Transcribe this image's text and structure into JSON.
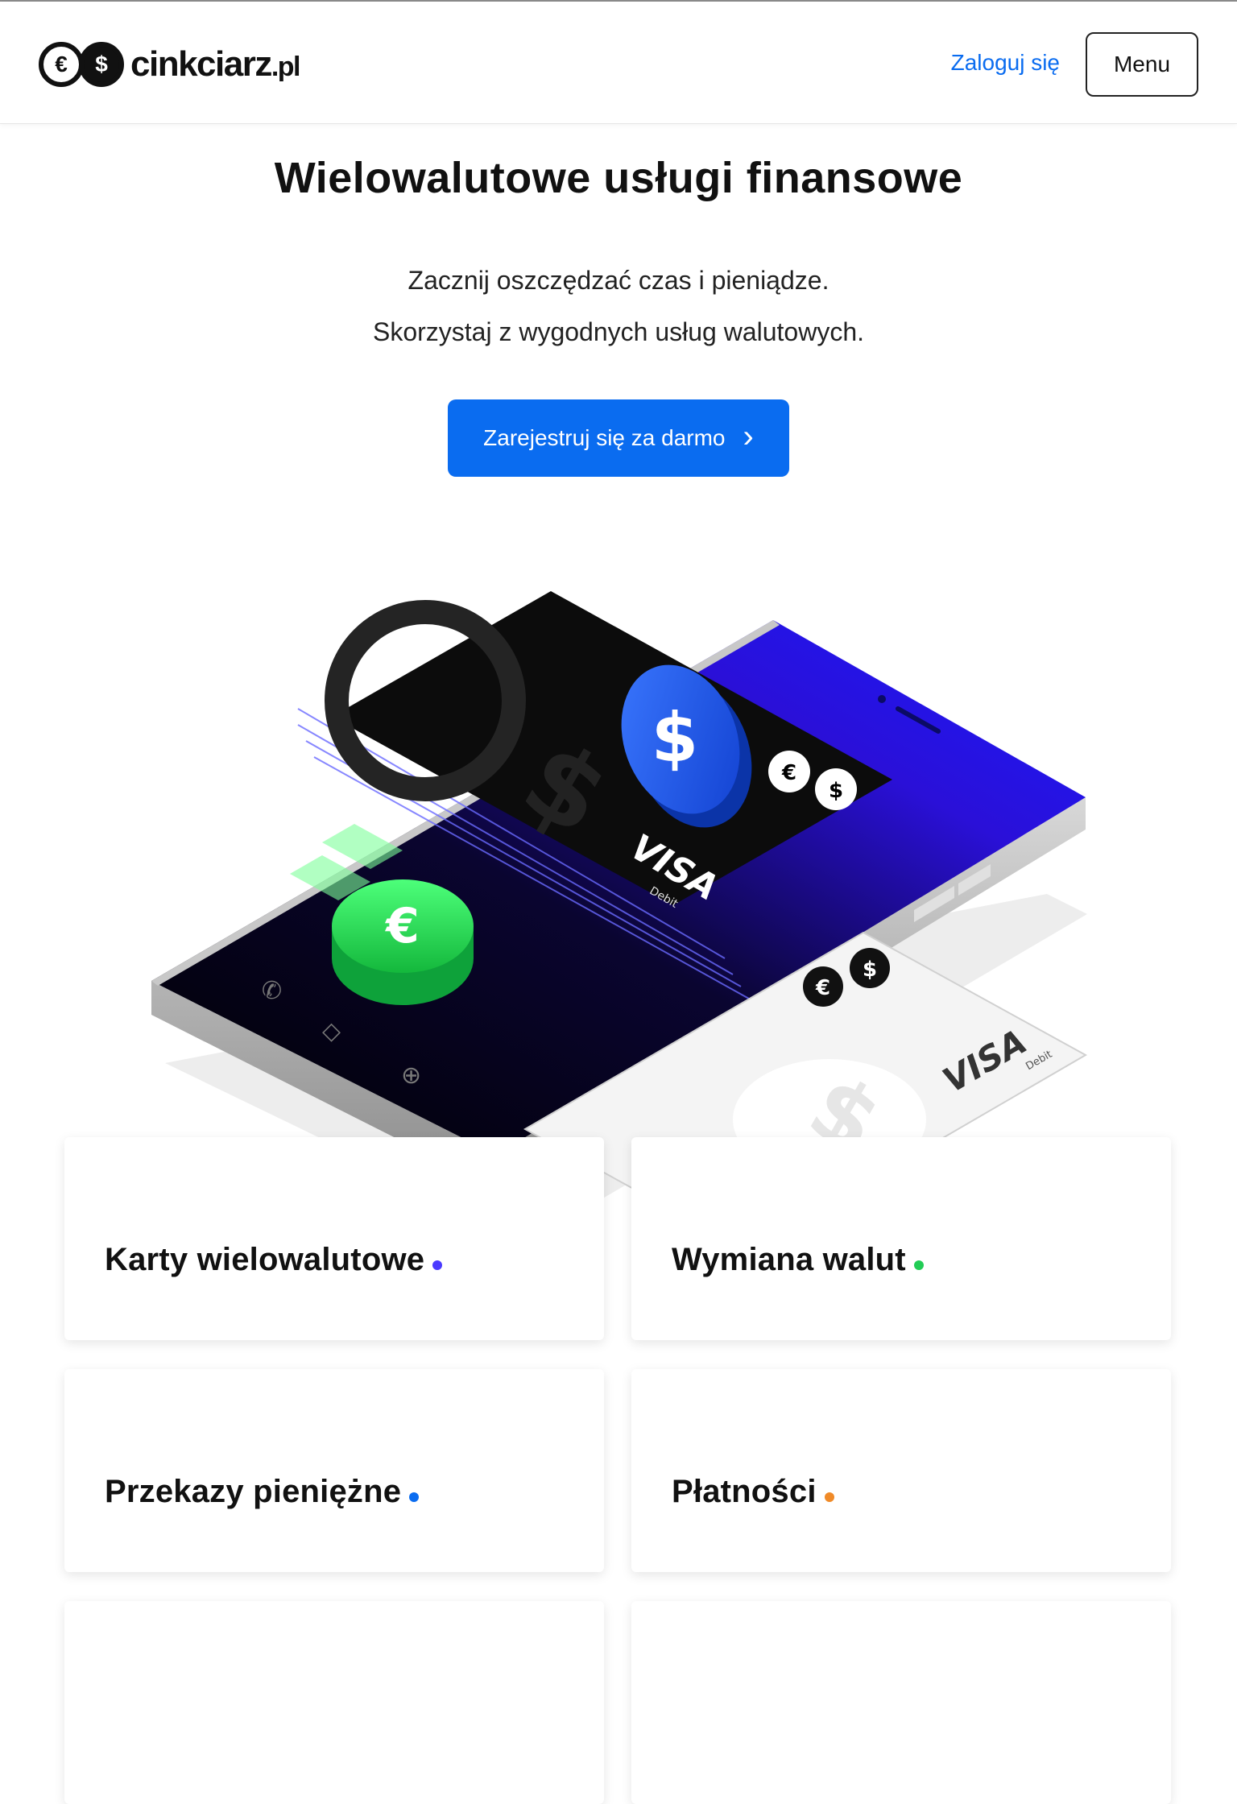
{
  "header": {
    "logo_text": "cinkciarz",
    "logo_suffix": ".pl",
    "logo_euro": "€",
    "logo_dollar": "$",
    "login_label": "Zaloguj się",
    "menu_label": "Menu"
  },
  "hero": {
    "title": "Wielowalutowe usługi finansowe",
    "subtitle_line1": "Zacznij oszczędzać czas i pieniądze.",
    "subtitle_line2": "Skorzystaj z wygodnych usług walutowych.",
    "cta_label": "Zarejestruj się za darmo",
    "card_brand": "VISA",
    "card_type": "Debit"
  },
  "services": [
    {
      "label": "Karty wielowalutowe",
      "dot_color": "#4a3aff"
    },
    {
      "label": "Wymiana walut",
      "dot_color": "#22cc55"
    },
    {
      "label": "Przekazy pieniężne",
      "dot_color": "#0a6cf0"
    },
    {
      "label": "Płatności",
      "dot_color": "#f08a28"
    }
  ],
  "colors": {
    "accent": "#0a6cf0",
    "coin_blue": "#1e5cff",
    "coin_green": "#22dd55"
  }
}
